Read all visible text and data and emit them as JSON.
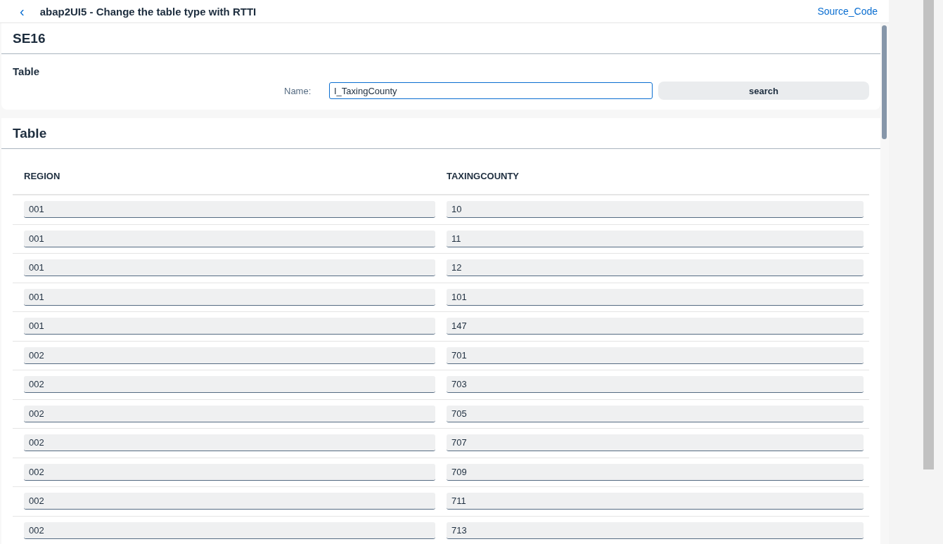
{
  "header": {
    "back_icon": "‹",
    "title": "abap2UI5 - Change the table type with RTTI",
    "link": "Source_Code"
  },
  "form": {
    "title": "SE16",
    "section": "Table",
    "label": "Name:",
    "value": "I_TaxingCounty",
    "button": "search"
  },
  "table": {
    "title": "Table",
    "columns": [
      "REGION",
      "TAXINGCOUNTY"
    ],
    "rows": [
      [
        "001",
        "10"
      ],
      [
        "001",
        "11"
      ],
      [
        "001",
        "12"
      ],
      [
        "001",
        "101"
      ],
      [
        "001",
        "147"
      ],
      [
        "002",
        "701"
      ],
      [
        "002",
        "703"
      ],
      [
        "002",
        "705"
      ],
      [
        "002",
        "707"
      ],
      [
        "002",
        "709"
      ],
      [
        "002",
        "711"
      ],
      [
        "002",
        "713"
      ]
    ]
  }
}
